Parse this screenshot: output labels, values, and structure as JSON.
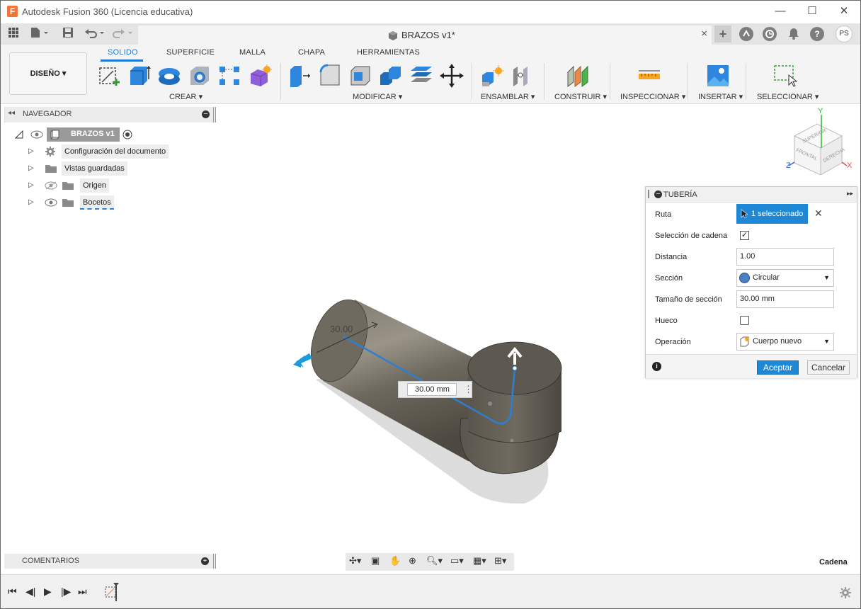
{
  "window": {
    "title": "Autodesk Fusion 360 (Licencia educativa)",
    "logo_letter": "F",
    "minimize": "—",
    "maximize": "☐",
    "close": "✕"
  },
  "tabbar": {
    "doc_title": "BRAZOS v1*",
    "tab_close": "×",
    "new_tab": "+",
    "user_initials": "PS"
  },
  "ribbon": {
    "workspace": "DISEÑO",
    "tabs": [
      "SOLIDO",
      "SUPERFICIE",
      "MALLA",
      "CHAPA",
      "HERRAMIENTAS"
    ],
    "groups": {
      "crear": "CREAR",
      "modificar": "MODIFICAR",
      "ensamblar": "ENSAMBLAR",
      "construir": "CONSTRUIR",
      "inspeccionar": "INSPECCIONAR",
      "insertar": "INSERTAR",
      "seleccionar": "SELECCIONAR"
    },
    "caret": "▾"
  },
  "browser": {
    "title": "NAVEGADOR",
    "root": "BRAZOS v1",
    "items": [
      "Configuración del documento",
      "Vistas guardadas",
      "Origen",
      "Bocetos"
    ]
  },
  "viewcube": {
    "top": "SUPERIOR",
    "front": "FRONTAL",
    "right": "DERECHA",
    "axis_x": "X",
    "axis_y": "Y",
    "axis_z": "Z"
  },
  "viewport": {
    "dimension_label": "30.00",
    "size_input": "30.00 mm"
  },
  "pipe_panel": {
    "title": "TUBERÍA",
    "rows": {
      "ruta": "Ruta",
      "ruta_value": "1 seleccionado",
      "cadena": "Selección de cadena",
      "distancia": "Distancia",
      "distancia_value": "1.00",
      "seccion": "Sección",
      "seccion_value": "Circular",
      "tamano": "Tamaño de sección",
      "tamano_value": "30.00 mm",
      "hueco": "Hueco",
      "operacion": "Operación",
      "operacion_value": "Cuerpo nuevo"
    },
    "cadena_checked": true,
    "hueco_checked": false,
    "ok": "Aceptar",
    "cancel": "Cancelar"
  },
  "bottom": {
    "comments": "COMENTARIOS",
    "status": "Cadena"
  },
  "colors": {
    "accent": "#1b79d4",
    "selected_button": "#1e88d6",
    "body": "#5e5a52"
  }
}
